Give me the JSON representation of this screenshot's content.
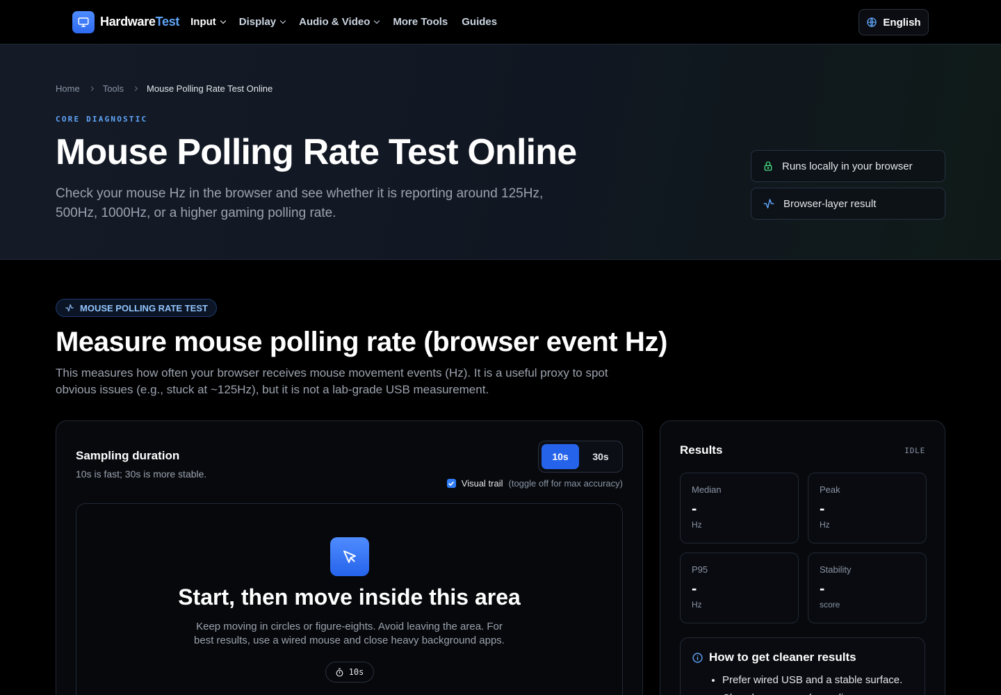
{
  "nav": {
    "logo_main": "Hardware",
    "logo_accent": "Test",
    "items": [
      {
        "label": "Input",
        "dropdown": true,
        "active": true
      },
      {
        "label": "Display",
        "dropdown": true
      },
      {
        "label": "Audio & Video",
        "dropdown": true
      },
      {
        "label": "More Tools",
        "dropdown": false
      },
      {
        "label": "Guides",
        "dropdown": false
      }
    ],
    "language": "English"
  },
  "hero": {
    "breadcrumb": [
      "Home",
      "Tools",
      "Mouse Polling Rate Test Online"
    ],
    "eyebrow": "CORE DIAGNOSTIC",
    "title": "Mouse Polling Rate Test Online",
    "subtitle": "Check your mouse Hz in the browser and see whether it is reporting around 125Hz, 500Hz, 1000Hz, or a higher gaming polling rate.",
    "badges": [
      "Runs locally in your browser",
      "Browser-layer result"
    ]
  },
  "main": {
    "pill": "MOUSE POLLING RATE TEST",
    "title": "Measure mouse polling rate (browser event Hz)",
    "description": "This measures how often your browser receives mouse movement events (Hz). It is a useful proxy to spot obvious issues (e.g., stuck at ~125Hz), but it is not a lab-grade USB measurement."
  },
  "sampler": {
    "title": "Sampling duration",
    "description": "10s is fast; 30s is more stable.",
    "options": [
      "10s",
      "30s"
    ],
    "selected": "10s",
    "trail_label": "Visual trail",
    "trail_note": "(toggle off for max accuracy)",
    "trail_checked": true,
    "area_title": "Start, then move inside this area",
    "area_desc": "Keep moving in circles or figure-eights. Avoid leaving the area. For best results, use a wired mouse and close heavy background apps.",
    "timer": "10s"
  },
  "results": {
    "title": "Results",
    "status": "IDLE",
    "stats": [
      {
        "label": "Median",
        "value": "-",
        "unit": "Hz"
      },
      {
        "label": "Peak",
        "value": "-",
        "unit": "Hz"
      },
      {
        "label": "P95",
        "value": "-",
        "unit": "Hz"
      },
      {
        "label": "Stability",
        "value": "-",
        "unit": "score"
      }
    ],
    "tips_title": "How to get cleaner results",
    "tips": [
      "Prefer wired USB and a stable surface.",
      "Close heavy apps (recording, game,"
    ]
  },
  "colors": {
    "accent": "#2563eb",
    "accent_light": "#60a5fa",
    "badge_lock": "#4ade80",
    "background": "#000000"
  }
}
